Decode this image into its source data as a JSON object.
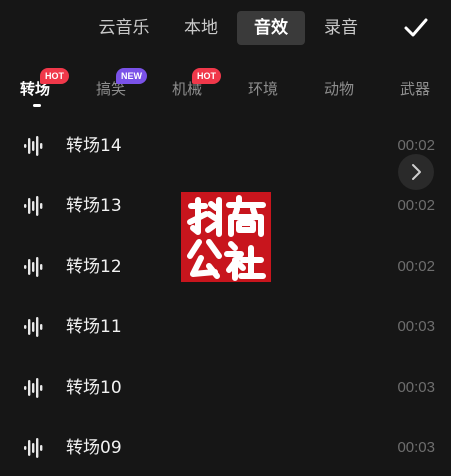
{
  "top_tabs": [
    "云音乐",
    "本地",
    "音效",
    "录音"
  ],
  "active_top_tab": "音效",
  "categories": [
    {
      "label": "转场",
      "badge": "HOT"
    },
    {
      "label": "搞笑",
      "badge": "NEW"
    },
    {
      "label": "机械",
      "badge": "HOT"
    },
    {
      "label": "环境",
      "badge": ""
    },
    {
      "label": "动物",
      "badge": ""
    },
    {
      "label": "武器",
      "badge": ""
    }
  ],
  "sounds": [
    {
      "name": "转场14",
      "duration": "00:02"
    },
    {
      "name": "转场13",
      "duration": "00:02"
    },
    {
      "name": "转场12",
      "duration": "00:02"
    },
    {
      "name": "转场11",
      "duration": "00:03"
    },
    {
      "name": "转场10",
      "duration": "00:03"
    },
    {
      "name": "转场09",
      "duration": "00:03"
    }
  ],
  "watermark_logo": {
    "text": "抖商公社",
    "color": "#c8151d"
  },
  "icons": {
    "confirm": "checkmark-icon",
    "waveform": "waveform-icon",
    "next": "chevron-right-icon"
  },
  "colors": {
    "background": "#161616",
    "hot_badge": "#f0384a",
    "new_badge": "#7a52e8"
  }
}
